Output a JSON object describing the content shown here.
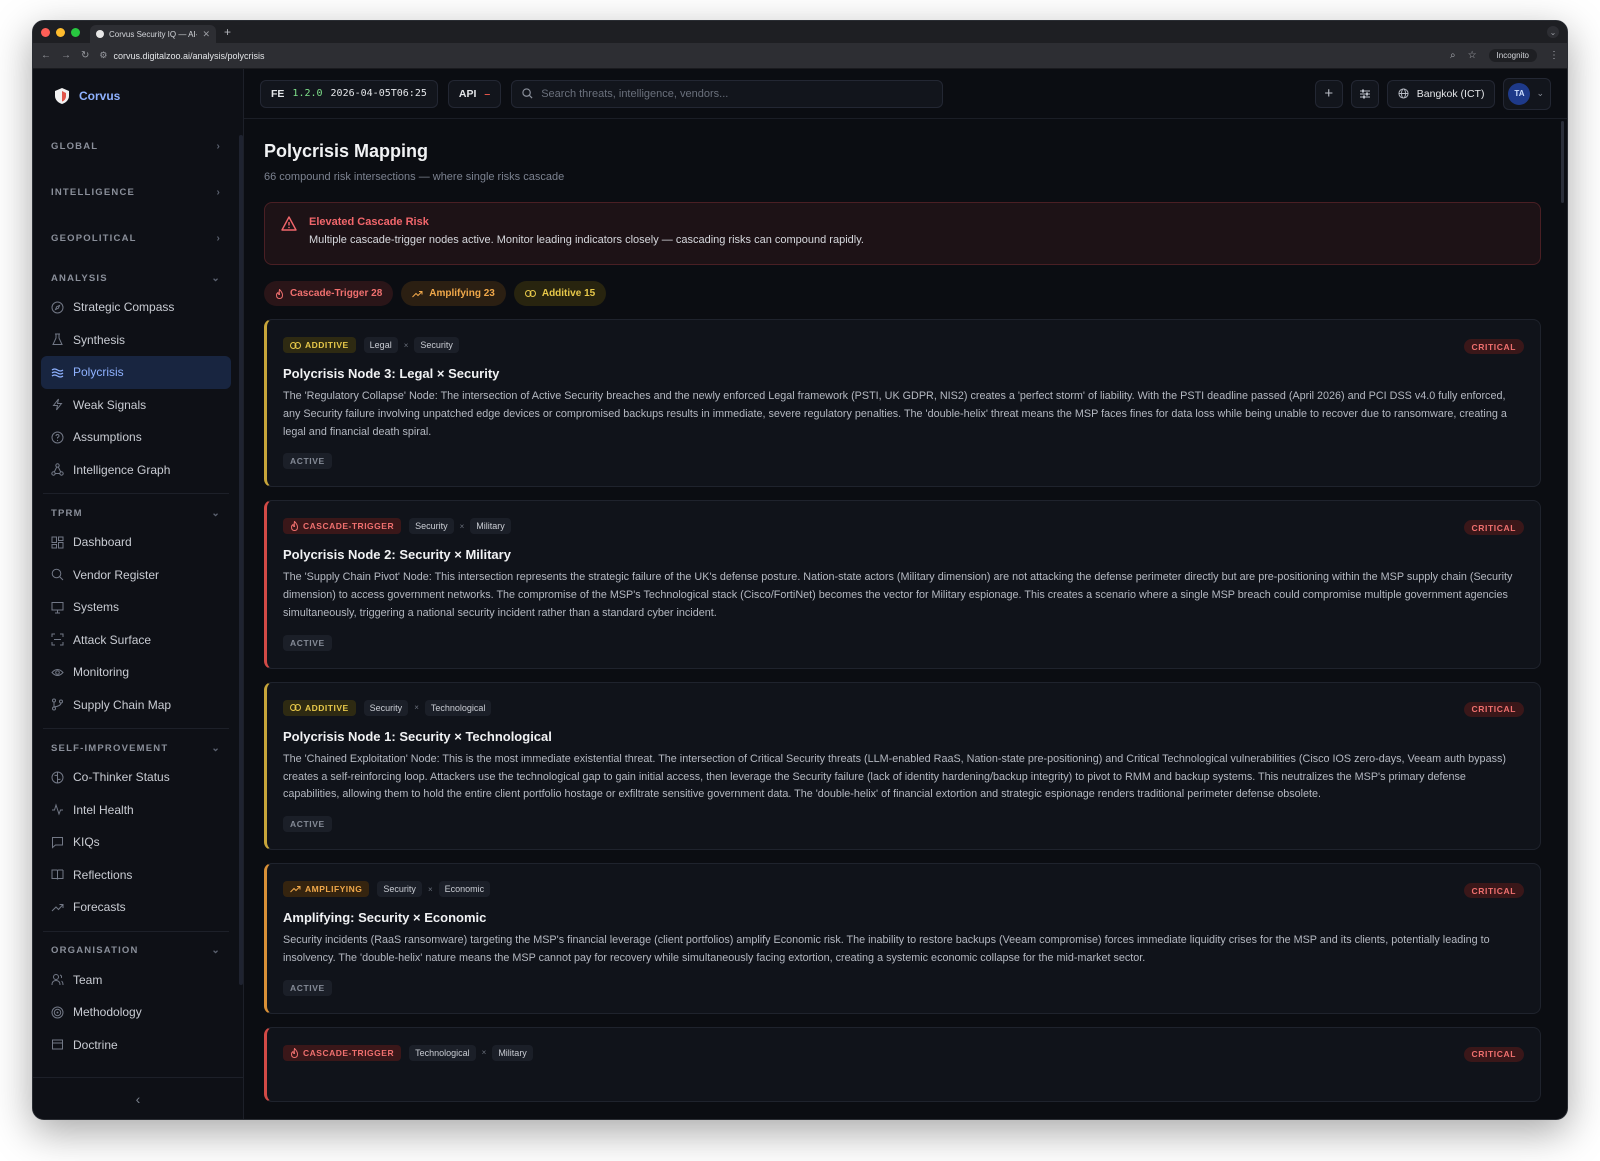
{
  "browser": {
    "tab_title": "Corvus Security IQ — AI-Pow",
    "url": "corvus.digitalzoo.ai/analysis/polycrisis",
    "incognito_label": "Incognito"
  },
  "sidebar": {
    "brand": "Corvus",
    "sections": [
      {
        "label": "GLOBAL",
        "items": []
      },
      {
        "label": "INTELLIGENCE",
        "items": []
      },
      {
        "label": "GEOPOLITICAL",
        "items": []
      },
      {
        "label": "ANALYSIS",
        "items": [
          {
            "label": "Strategic Compass",
            "icon": "compass-icon"
          },
          {
            "label": "Synthesis",
            "icon": "flask-icon"
          },
          {
            "label": "Polycrisis",
            "icon": "waves-icon",
            "active": true
          },
          {
            "label": "Weak Signals",
            "icon": "zap-icon"
          },
          {
            "label": "Assumptions",
            "icon": "help-circle-icon"
          },
          {
            "label": "Intelligence Graph",
            "icon": "graph-icon"
          }
        ]
      },
      {
        "label": "TPRM",
        "items": [
          {
            "label": "Dashboard",
            "icon": "grid-icon"
          },
          {
            "label": "Vendor Register",
            "icon": "search-icon"
          },
          {
            "label": "Systems",
            "icon": "monitor-icon"
          },
          {
            "label": "Attack Surface",
            "icon": "scan-icon"
          },
          {
            "label": "Monitoring",
            "icon": "eye-icon"
          },
          {
            "label": "Supply Chain Map",
            "icon": "git-branch-icon"
          }
        ]
      },
      {
        "label": "SELF-IMPROVEMENT",
        "items": [
          {
            "label": "Co-Thinker Status",
            "icon": "brain-icon"
          },
          {
            "label": "Intel Health",
            "icon": "activity-icon"
          },
          {
            "label": "KIQs",
            "icon": "message-square-icon"
          },
          {
            "label": "Reflections",
            "icon": "book-icon"
          },
          {
            "label": "Forecasts",
            "icon": "trending-up-icon"
          }
        ]
      },
      {
        "label": "ORGANISATION",
        "items": [
          {
            "label": "Team",
            "icon": "users-icon"
          },
          {
            "label": "Methodology",
            "icon": "target-icon"
          },
          {
            "label": "Doctrine",
            "icon": "file-icon"
          }
        ]
      }
    ]
  },
  "topbar": {
    "fe_label": "FE",
    "version": "1.2.0",
    "timestamp": "2026-04-05T06:25",
    "api_label": "API",
    "api_status": "–",
    "search_placeholder": "Search threats, intelligence, vendors...",
    "timezone": "Bangkok (ICT)",
    "avatar_initials": "TA"
  },
  "page": {
    "title": "Polycrisis Mapping",
    "subtitle": "66 compound risk intersections — where single risks cascade",
    "alert_title": "Elevated Cascade Risk",
    "alert_message": "Multiple cascade-trigger nodes active. Monitor leading indicators closely — cascading risks can compound rapidly.",
    "filters": [
      {
        "label": "Cascade-Trigger 28",
        "kind": "cascade"
      },
      {
        "label": "Amplifying 23",
        "kind": "amplifying"
      },
      {
        "label": "Additive 15",
        "kind": "additive"
      }
    ],
    "nodes": [
      {
        "type_label": "ADDITIVE",
        "kind": "additive",
        "dims": [
          "Legal",
          "Security"
        ],
        "severity": "CRITICAL",
        "title": "Polycrisis Node 3: Legal × Security",
        "body": "The 'Regulatory Collapse' Node: The intersection of Active Security breaches and the newly enforced Legal framework (PSTI, UK GDPR, NIS2) creates a 'perfect storm' of liability. With the PSTI deadline passed (April 2026) and PCI DSS v4.0 fully enforced, any Security failure involving unpatched edge devices or compromised backups results in immediate, severe regulatory penalties. The 'double-helix' threat means the MSP faces fines for data loss while being unable to recover due to ransomware, creating a legal and financial death spiral.",
        "status": "ACTIVE"
      },
      {
        "type_label": "CASCADE-TRIGGER",
        "kind": "cascade",
        "dims": [
          "Security",
          "Military"
        ],
        "severity": "CRITICAL",
        "title": "Polycrisis Node 2: Security × Military",
        "body": "The 'Supply Chain Pivot' Node: This intersection represents the strategic failure of the UK's defense posture. Nation-state actors (Military dimension) are not attacking the defense perimeter directly but are pre-positioning within the MSP supply chain (Security dimension) to access government networks. The compromise of the MSP's Technological stack (Cisco/FortiNet) becomes the vector for Military espionage. This creates a scenario where a single MSP breach could compromise multiple government agencies simultaneously, triggering a national security incident rather than a standard cyber incident.",
        "status": "ACTIVE"
      },
      {
        "type_label": "ADDITIVE",
        "kind": "additive",
        "dims": [
          "Security",
          "Technological"
        ],
        "severity": "CRITICAL",
        "title": "Polycrisis Node 1: Security × Technological",
        "body": "The 'Chained Exploitation' Node: This is the most immediate existential threat. The intersection of Critical Security threats (LLM-enabled RaaS, Nation-state pre-positioning) and Critical Technological vulnerabilities (Cisco IOS zero-days, Veeam auth bypass) creates a self-reinforcing loop. Attackers use the technological gap to gain initial access, then leverage the Security failure (lack of identity hardening/backup integrity) to pivot to RMM and backup systems. This neutralizes the MSP's primary defense capabilities, allowing them to hold the entire client portfolio hostage or exfiltrate sensitive government data. The 'double-helix' of financial extortion and strategic espionage renders traditional perimeter defense obsolete.",
        "status": "ACTIVE"
      },
      {
        "type_label": "AMPLIFYING",
        "kind": "amplifying",
        "dims": [
          "Security",
          "Economic"
        ],
        "severity": "CRITICAL",
        "title": "Amplifying: Security × Economic",
        "body": "Security incidents (RaaS ransomware) targeting the MSP's financial leverage (client portfolios) amplify Economic risk. The inability to restore backups (Veeam compromise) forces immediate liquidity crises for the MSP and its clients, potentially leading to insolvency. The 'double-helix' nature means the MSP cannot pay for recovery while simultaneously facing extortion, creating a systemic economic collapse for the mid-market sector.",
        "status": "ACTIVE"
      },
      {
        "type_label": "CASCADE-TRIGGER",
        "kind": "cascade",
        "dims": [
          "Technological",
          "Military"
        ],
        "severity": "CRITICAL",
        "title": "",
        "body": "",
        "status": ""
      }
    ]
  },
  "colors": {
    "accent": "#8fb2ff",
    "critical": "#f0706f",
    "additive": "#e7c84a",
    "amplifying": "#f0a84a",
    "background": "#0b0d12"
  }
}
